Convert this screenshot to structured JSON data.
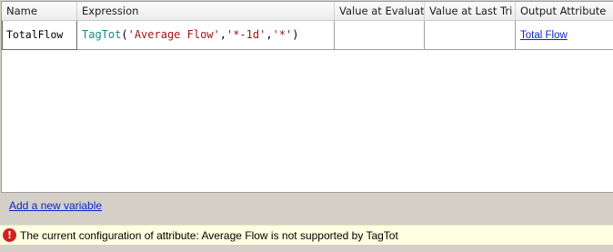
{
  "grid": {
    "columns": [
      "Name",
      "Expression",
      "Value at Evaluati",
      "Value at Last Tri",
      "Output Attribute"
    ],
    "rows": [
      {
        "name": "TotalFlow",
        "expression": {
          "fn": "TagTot",
          "open": "(",
          "arg1": "'Average Flow'",
          "sep1": ",",
          "arg2": "'*-1d'",
          "sep2": ",",
          "arg3": "'*'",
          "close": ")"
        },
        "value_at_evaluation": "",
        "value_at_last_trigger": "",
        "output_attribute": "Total Flow"
      }
    ]
  },
  "add_variable_label": "Add a new variable",
  "status": {
    "icon": "error-icon",
    "icon_glyph": "!",
    "message": "The current configuration of attribute: Average Flow is not supported by TagTot"
  },
  "colors": {
    "function": "#1a8a8a",
    "string": "#a31515",
    "link": "#0b24c7",
    "error": "#d21f1f",
    "status_bg": "#ffffe1"
  }
}
